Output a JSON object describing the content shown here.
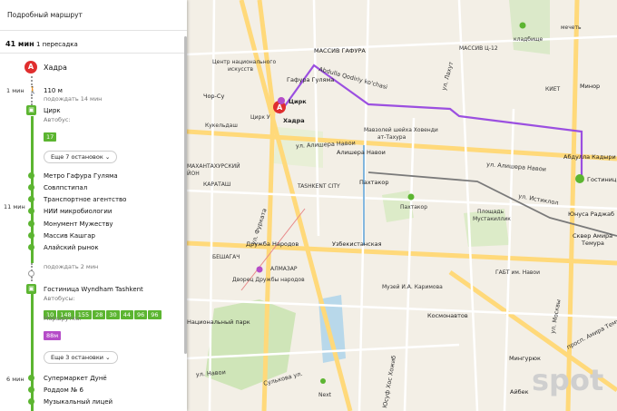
{
  "panel": {
    "title": "Подробный маршрут",
    "total_time": "41 мин",
    "transfers": "1 пересадка",
    "origin": {
      "letter": "А",
      "name": "Хадра"
    },
    "walk": {
      "time": "1 мин",
      "distance": "110 м",
      "wait": "подождать 14 мин"
    },
    "leg1": {
      "stop": "Цирк",
      "type_label": "Автобус:",
      "routes": [
        "17"
      ],
      "more_stops": "Еще 7 остановок",
      "time": "11 мин",
      "stops": [
        "Метро Гафура Гуляма",
        "Совлпстипал",
        "Транспортное агентство",
        "НИИ микробиологии",
        "Монумент Мужеству",
        "Массив Кашгар",
        "Алайский рынок"
      ]
    },
    "wait2": "подождать 2 мин",
    "leg2": {
      "stop": "Гостиница Wyndham Tashkent",
      "bus_label": "Автобусы:",
      "bus_routes": [
        "10",
        "148",
        "155",
        "28",
        "30",
        "44",
        "96",
        "96"
      ],
      "minibus_label": "Маршрутка:",
      "minibus_routes": [
        "88м"
      ],
      "more_stops": "Еще 3 остановки",
      "time": "6 мин",
      "stops": [
        "Супермаркет Дунё",
        "Роддом № 6",
        "Музыкальный лицей"
      ]
    }
  },
  "map": {
    "labels": {
      "massiv_gafura": "МАССИВ ГАФУРА",
      "massiv_ts12": "МАССИВ Ц-12",
      "kladbishche": "кладбище",
      "minor_mosque": "мечеть",
      "art_center": "Центр национального",
      "art_center2": "искусств",
      "chor_su": "Чор-Су",
      "gafura_gulyama": "Гафура Гуляма",
      "tsirk": "Цирк",
      "tsirk_u": "Цирк У",
      "hadra_label": "Хадра",
      "kukeldash": "Кукельдаш",
      "mavzoley": "Мавзолей шейха Ховенди",
      "mavzoley2": "ат-Тахура",
      "alisher_navoi_metro": "Алишера Навои",
      "kiyet": "КИЕТ",
      "minor": "Минор",
      "abdulla_kadyri": "Абдулла Кадыри",
      "hotel": "Гостиниц",
      "mahallatar": "МАХАНТАХУРСКИЙ",
      "mahallatar2": "ЙОН",
      "karatash": "КАРАТАШ",
      "tashkent_city": "TASHKENT CITY",
      "paxtakor": "Пахтакор",
      "paxtakor_stadium": "Пахтакор",
      "ploshchad": "Площадь",
      "ploshchad2": "Мустакиллик",
      "yunusa": "Юнуса Раджаб",
      "amir_temur": "Сквер Амира",
      "amir_temur2": "Темура",
      "druzhba": "Дружба Народов",
      "uzbekistanskaya": "Узбекистанская",
      "beshagach": "БЕШАГАЧ",
      "dvorets": "Дворец Дружбы народов",
      "almazar": "АЛМАЗАР",
      "gabt": "ГАБТ им. Навои",
      "muzey": "Музей И.А. Каримова",
      "national_park": "Национальный парк",
      "kosmonavty": "Космонавтов",
      "mingurik": "Мингурюк",
      "aybek": "Айбек",
      "next": "Next",
      "spot": "spot"
    },
    "roads": {
      "furkata": "ул. Фурката",
      "alishera1": "ул. Алишера Навои",
      "alishera2": "ул. Алишера Навои",
      "navoi": "ул. Навои",
      "abdulla_doniy": "Abdulla Qodiriy ko'chasi",
      "lakhut": "ул. Лахут",
      "sulkova": "Сулькова ул.",
      "istiklol": "ул. Истиклол",
      "moskvy": "ул. Москвы",
      "amira_temura": "просп. Амира Темура",
      "yusuf": "Юсуф Хос Хожиб"
    },
    "colors": {
      "route": "#9b4fe0",
      "metro_line": "#7a7a7a",
      "bus": "#5cb531",
      "pin": "#e02e2e"
    }
  }
}
